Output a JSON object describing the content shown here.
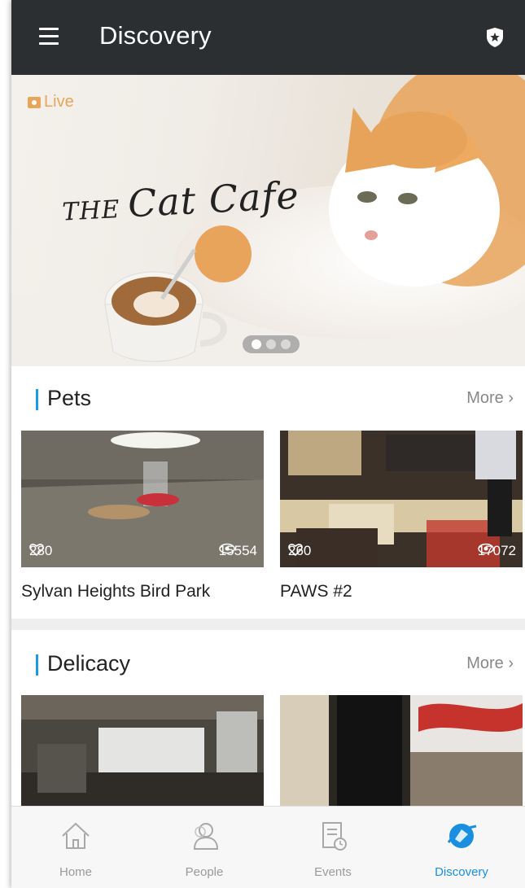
{
  "app": {
    "title": "Discovery"
  },
  "banner": {
    "live_label": "Live",
    "title_small": "THE",
    "title_main": "Cat Cafe",
    "pager": {
      "count": 3,
      "active": 0
    }
  },
  "sections": [
    {
      "title": "Pets",
      "more_label": "More",
      "cards": [
        {
          "title": "Sylvan Heights Bird Park",
          "likes": "280",
          "views": "15554"
        },
        {
          "title": "PAWS #2",
          "likes": "260",
          "views": "17072"
        }
      ]
    },
    {
      "title": "Delicacy",
      "more_label": "More",
      "cards": [
        {
          "title": ""
        },
        {
          "title": ""
        }
      ]
    }
  ],
  "tabs": [
    {
      "label": "Home",
      "icon": "home-icon",
      "active": false
    },
    {
      "label": "People",
      "icon": "people-icon",
      "active": false
    },
    {
      "label": "Events",
      "icon": "events-icon",
      "active": false
    },
    {
      "label": "Discovery",
      "icon": "discovery-icon",
      "active": true
    }
  ],
  "colors": {
    "topbar": "#2b2f31",
    "accent": "#1a9be6",
    "live": "#e8a55a"
  }
}
